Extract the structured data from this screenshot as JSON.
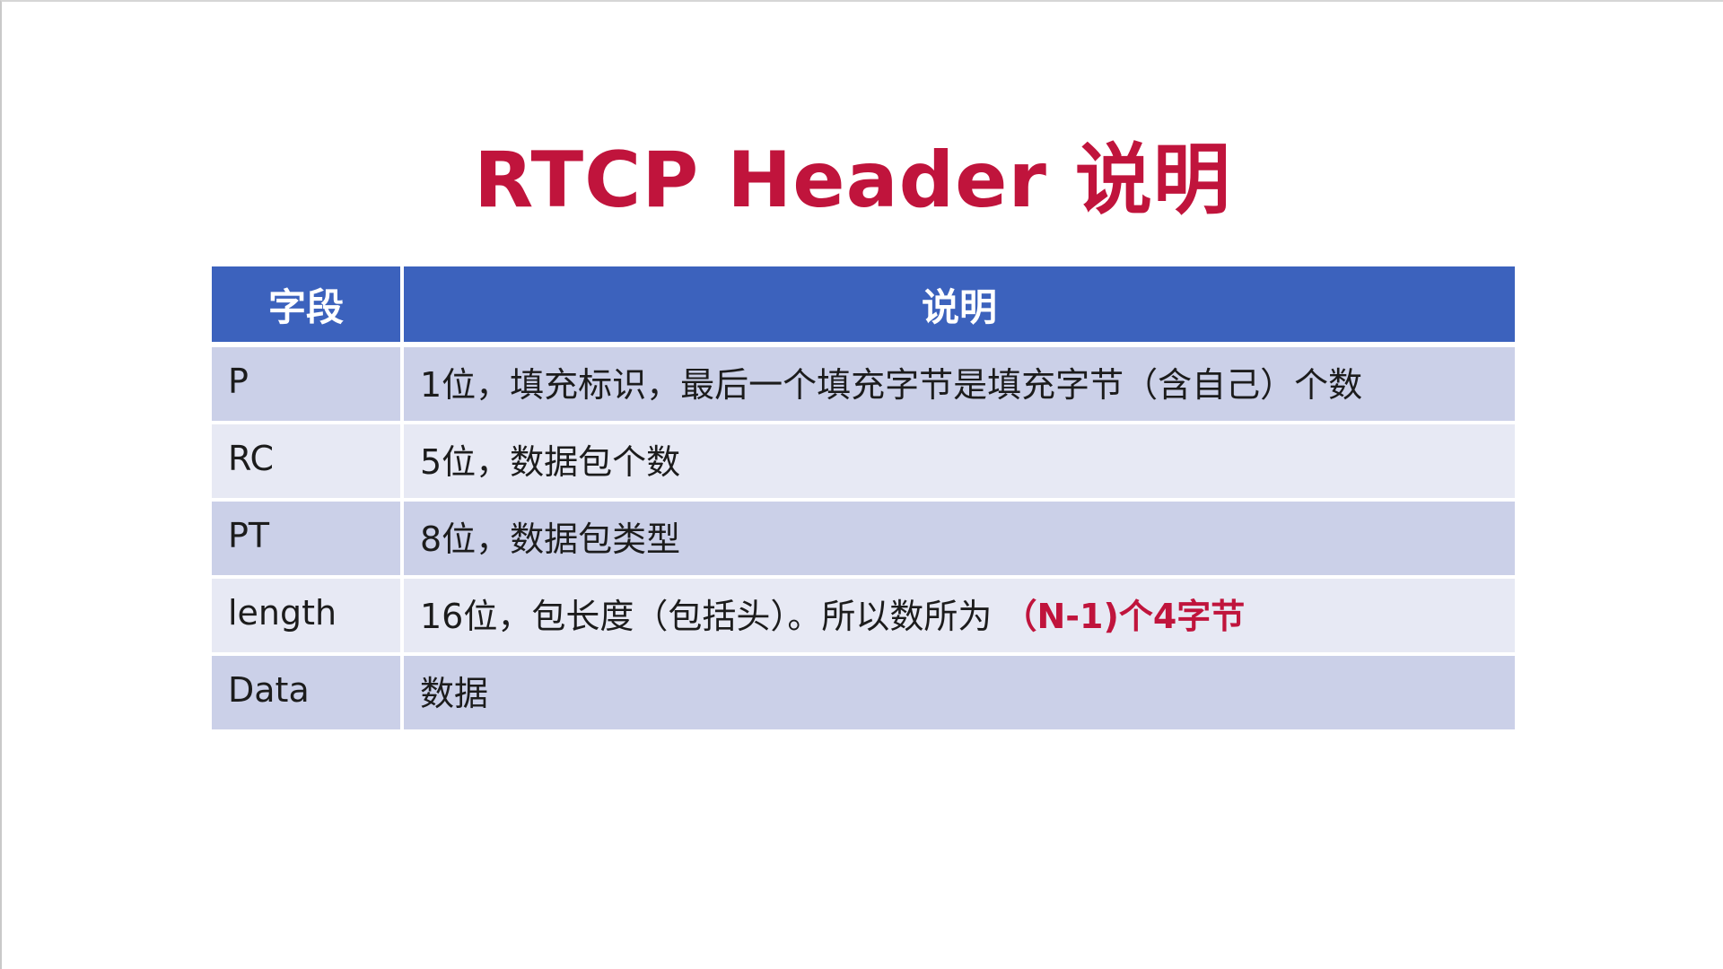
{
  "slide": {
    "title": "RTCP Header 说明"
  },
  "table": {
    "headers": [
      "字段",
      "说明"
    ],
    "rows": [
      {
        "field": "P",
        "description": "1位，填充标识，最后一个填充字节是填充字节（含自己）个数",
        "highlight": ""
      },
      {
        "field": "RC",
        "description": "5位，数据包个数",
        "highlight": ""
      },
      {
        "field": "PT",
        "description": "8位，数据包类型",
        "highlight": ""
      },
      {
        "field": "length",
        "description": "16位，包长度（包括头）。所以数所为 ",
        "highlight": "（N-1)个4字节"
      },
      {
        "field": "Data",
        "description": "数据",
        "highlight": ""
      }
    ]
  },
  "colors": {
    "title": "#c0143c",
    "header_bg": "#3c62bd",
    "row_dark": "#cbd0e8",
    "row_light": "#e7e9f4",
    "highlight": "#c0143c"
  }
}
